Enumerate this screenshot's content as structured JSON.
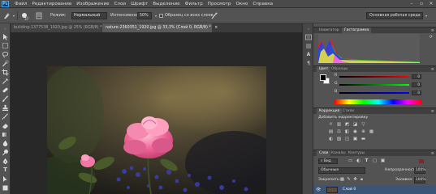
{
  "app": {
    "logo": "Ps"
  },
  "menu": [
    "Файл",
    "Редактирование",
    "Изображение",
    "Слои",
    "Шрифт",
    "Выделение",
    "Фильтр",
    "Просмотр",
    "Окно",
    "Справка"
  ],
  "window_controls": [
    "–",
    "▫",
    "✕"
  ],
  "options": {
    "size_value": "37",
    "mode_label": "Режим:",
    "mode_value": "Нормальный",
    "intensity_label": "Интенсивность:",
    "intensity_value": "50%",
    "sample_all_label": "Образец со всех слоев",
    "workspace": "Основная рабочая среда"
  },
  "doc_tabs": [
    {
      "label": "building-1377538_1920.jpg @ 25% (RGB/8) *",
      "close": "×"
    },
    {
      "label": "nature-2360351_1920.jpg @ 33,3% (Слой 0, RGB/8) *",
      "close": "×"
    }
  ],
  "panels": {
    "navigator_tabs": [
      "Навигатор",
      "Гистограмма"
    ],
    "color_tabs": [
      "Цвет",
      "Образцы"
    ],
    "color_values": {
      "r": "0",
      "g": "0",
      "b": "0"
    },
    "correction_tabs": [
      "Коррекция",
      "Стили"
    ],
    "add_correction": "Добавить корректировку",
    "layers_tabs": [
      "Слои",
      "Каналы",
      "Контуры"
    ],
    "layers_kind": "Вид",
    "blend_mode": "Обычные",
    "opacity_label": "Непрозрачность:",
    "opacity_value": "100%",
    "lock_label": "Закрепить:",
    "fill_label": "Заливка:",
    "fill_value": "100%",
    "layer_name": "Слой 0"
  },
  "colors": {
    "ui_bg": "#535353",
    "menubar": "#4a4a4a",
    "canvas_bg": "#282828",
    "active_tab": "#5a5a5a",
    "rose": "#f06a9a"
  },
  "icons": [
    "move-icon",
    "marquee-icon",
    "lasso-icon",
    "quick-select-icon",
    "crop-icon",
    "eyedropper-icon",
    "healing-icon",
    "brush-icon",
    "clone-stamp-icon",
    "history-brush-icon",
    "eraser-icon",
    "gradient-icon",
    "blur-icon",
    "dodge-icon",
    "pen-icon",
    "type-icon",
    "path-select-icon",
    "shape-icon"
  ]
}
